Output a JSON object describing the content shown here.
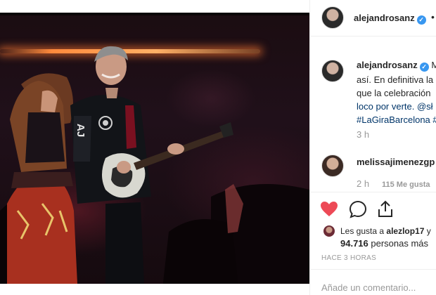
{
  "post_author": {
    "username": "alejandrosanz",
    "verified_icon": "verified-badge-icon",
    "more_label": "•"
  },
  "caption": {
    "username": "alejandrosanz",
    "lines": [
      "M",
      "así. En definitiva la",
      "que la celebración",
      "loco por verte. @sł",
      "#LaGiraBarcelona #"
    ],
    "time": "3 h"
  },
  "comments": [
    {
      "username": "melissajimenezgp",
      "time": "2 h",
      "likes": "115 Me gusta"
    }
  ],
  "actions": {
    "like_icon": "heart-filled-icon",
    "comment_icon": "comment-bubble-icon",
    "share_icon": "share-upload-icon",
    "like_color": "#ed4956"
  },
  "likes_summary": {
    "prefix": "Les gusta a ",
    "user": "alezlop17",
    "suffix": " y",
    "count": "94.716",
    "count_suffix": " personas más"
  },
  "timestamp": "HACE 3 HORAS",
  "comment_input": {
    "placeholder": "Añade un comentario..."
  }
}
